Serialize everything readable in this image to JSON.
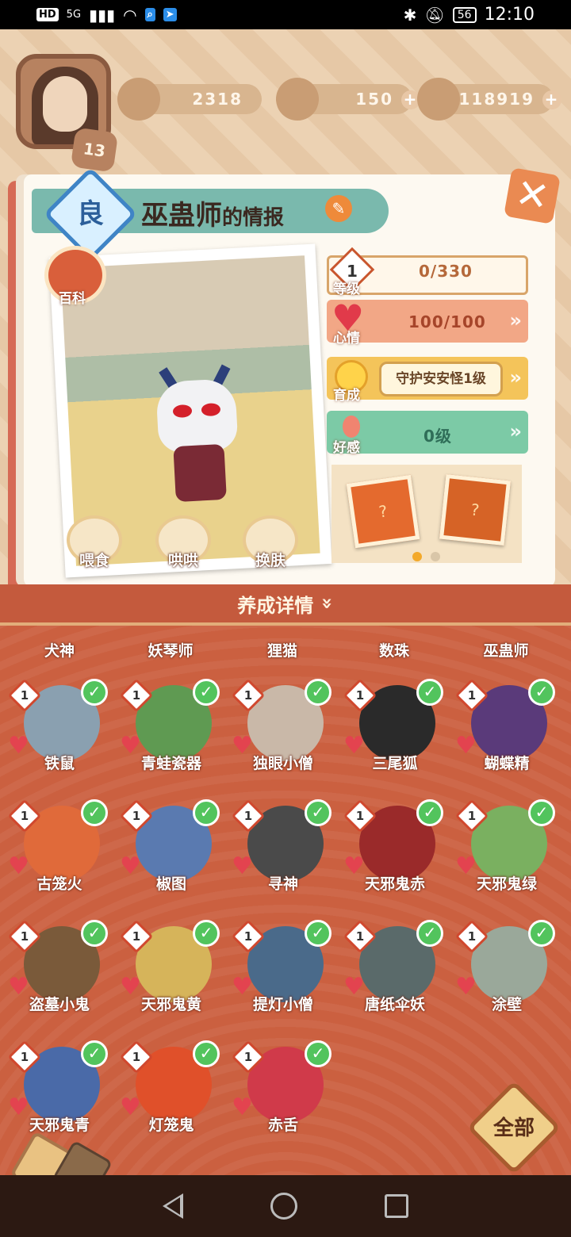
{
  "status_bar": {
    "time": "12:10",
    "battery": "56",
    "network": "5G",
    "left_chip": "HD"
  },
  "resources": {
    "level": "13",
    "jade": "2318",
    "stamina": "150",
    "coins": "118919"
  },
  "card": {
    "grade": "良",
    "title_main": "巫蛊师",
    "title_suffix": "的情报",
    "baike": "百科",
    "actions": [
      "喂食",
      "哄哄",
      "换肤"
    ]
  },
  "stats": {
    "level_label": "等级",
    "level_value": "1",
    "exp": "0/330",
    "mood_label": "心情",
    "mood_value": "100/100",
    "nurture_label": "育成",
    "nurture_task": "守护安安怪1级",
    "favor_label": "好感",
    "favor_value": "0级"
  },
  "panel": {
    "header": "养成详情",
    "top_row": [
      "犬神",
      "妖琴师",
      "狸猫",
      "数珠",
      "巫蛊师"
    ],
    "items": [
      {
        "name": "铁鼠",
        "level": "1"
      },
      {
        "name": "青蛙瓷器",
        "level": "1"
      },
      {
        "name": "独眼小僧",
        "level": "1"
      },
      {
        "name": "三尾狐",
        "level": "1"
      },
      {
        "name": "蝴蝶精",
        "level": "1"
      },
      {
        "name": "古笼火",
        "level": "1"
      },
      {
        "name": "椒图",
        "level": "1"
      },
      {
        "name": "寻神",
        "level": "1"
      },
      {
        "name": "天邪鬼赤",
        "level": "1"
      },
      {
        "name": "天邪鬼绿",
        "level": "1"
      },
      {
        "name": "盗墓小鬼",
        "level": "1"
      },
      {
        "name": "天邪鬼黄",
        "level": "1"
      },
      {
        "name": "提灯小僧",
        "level": "1"
      },
      {
        "name": "唐纸伞妖",
        "level": "1"
      },
      {
        "name": "涂壁",
        "level": "1"
      },
      {
        "name": "天邪鬼青",
        "level": "1"
      },
      {
        "name": "灯笼鬼",
        "level": "1"
      },
      {
        "name": "赤舌",
        "level": "1"
      }
    ],
    "all_button": "全部"
  }
}
